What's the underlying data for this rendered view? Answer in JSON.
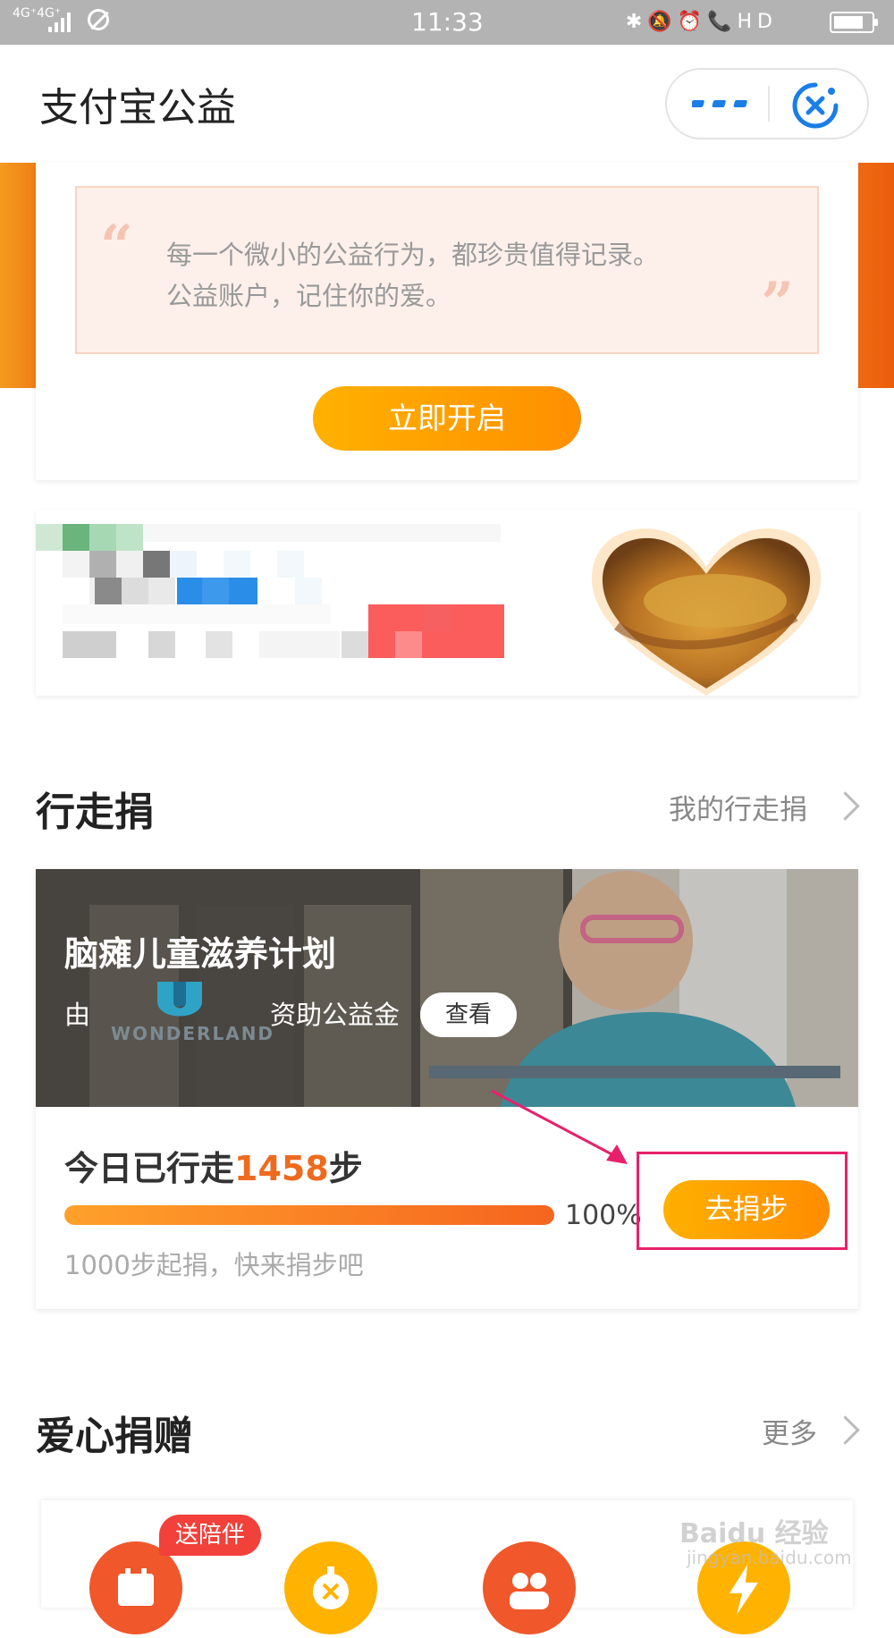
{
  "status_bar": {
    "network": "4G⁺4G⁺",
    "time": "11:33",
    "icons": "✱🔕⏰📞HD"
  },
  "header": {
    "title": "支付宝公益",
    "more_icon": "more-dots-icon",
    "close_icon": "close-circle-icon"
  },
  "banner": {
    "quote_open": "“",
    "quote_close": "”",
    "line1": "每一个微小的公益行为，都珍贵值得记录。",
    "line2": "公益账户，记住你的爱。",
    "button": "立即开启",
    "accent_left": "#f39a1f",
    "accent_right": "#ea5d0c"
  },
  "walk": {
    "section_title": "行走捐",
    "section_link": "我的行走捐",
    "project_title": "脑瘫儿童滋养计划",
    "by": "由",
    "sponsor_logo": "WONDERLAND",
    "fund": "资助公益金",
    "view_button": "查看",
    "steps_prefix": "今日已行走",
    "steps_value": "1458",
    "steps_suffix": "步",
    "progress_percent": 100,
    "progress_label": "100%",
    "hint": "1000步起捐，快来捐步吧",
    "donate_button": "去捐步",
    "highlight_color": "#e8206c"
  },
  "donation": {
    "section_title": "爱心捐赠",
    "section_link": "更多",
    "badge": "送陪伴",
    "icons": [
      "calendar-icon",
      "timer-icon",
      "people-icon",
      "lightning-icon"
    ],
    "icon_colors": [
      "#f0572a",
      "#ffb300",
      "#f0572a",
      "#ffb300"
    ]
  },
  "watermark": {
    "line1": "Baidu 经验",
    "line2": "jingyan.baidu.com"
  }
}
